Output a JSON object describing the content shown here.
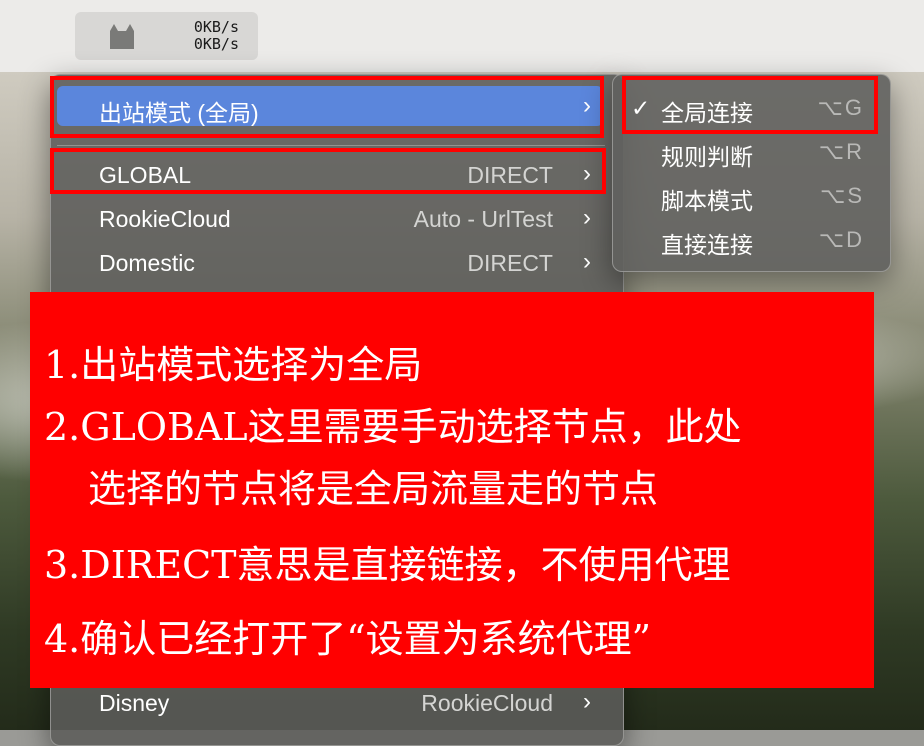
{
  "status_bar": {
    "upload_speed": "0KB/s",
    "download_speed": "0KB/s"
  },
  "menu": {
    "items": [
      {
        "label": "出站模式 (全局)",
        "value": "",
        "highlighted": true
      },
      {
        "label": "GLOBAL",
        "value": "DIRECT"
      },
      {
        "label": "RookieCloud",
        "value": "Auto - UrlTest"
      },
      {
        "label": "Domestic",
        "value": "DIRECT"
      },
      {
        "label": "Disney",
        "value": "RookieCloud"
      }
    ],
    "chevron": "›"
  },
  "submenu": {
    "items": [
      {
        "label": "全局连接",
        "shortcut": "⌥G",
        "checked": true
      },
      {
        "label": "规则判断",
        "shortcut": "⌥R"
      },
      {
        "label": "脚本模式",
        "shortcut": "⌥S"
      },
      {
        "label": "直接连接",
        "shortcut": "⌥D"
      }
    ],
    "check_mark": "✓"
  },
  "annotation": {
    "lines": [
      "1.出站模式选择为全局",
      "2.GLOBAL这里需要手动选择节点，此处",
      "选择的节点将是全局流量走的节点",
      "3.DIRECT意思是直接链接，不使用代理",
      "4.确认已经打开了“设置为系统代理”"
    ]
  },
  "colors": {
    "highlight": "#5b86dc",
    "annotation_bg": "#ff0000",
    "outline": "#ff0000"
  }
}
